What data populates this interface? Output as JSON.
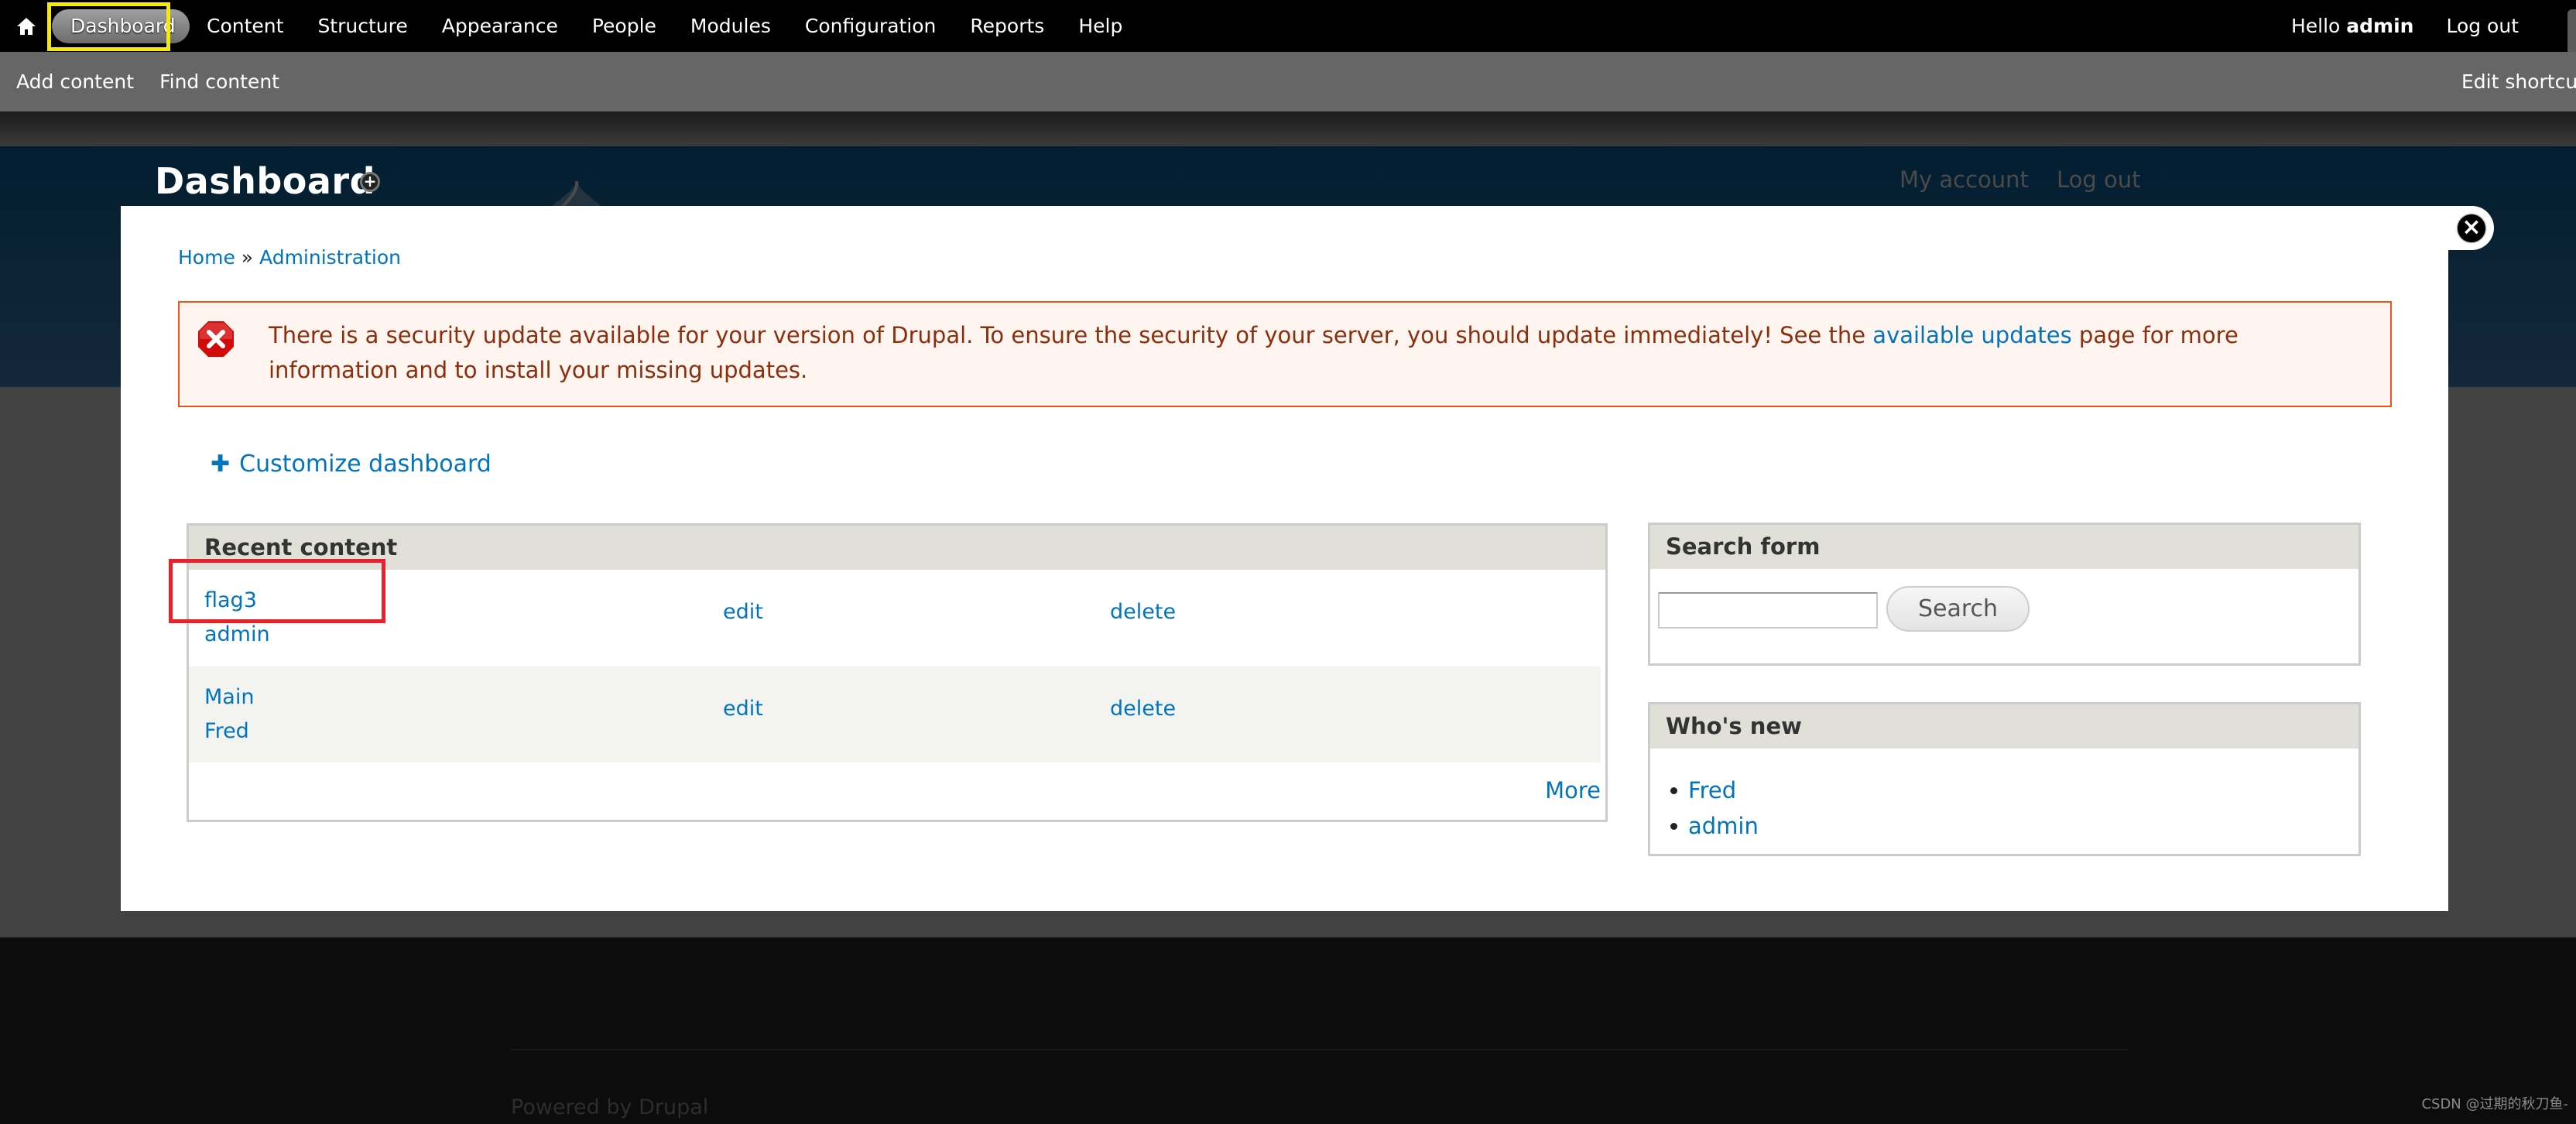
{
  "toolbar": {
    "home_icon": "home-icon",
    "menu": [
      {
        "label": "Dashboard",
        "active": true
      },
      {
        "label": "Content"
      },
      {
        "label": "Structure"
      },
      {
        "label": "Appearance"
      },
      {
        "label": "People"
      },
      {
        "label": "Modules"
      },
      {
        "label": "Configuration"
      },
      {
        "label": "Reports"
      },
      {
        "label": "Help"
      }
    ],
    "greeting_prefix": "Hello",
    "username": "admin",
    "logout": "Log out"
  },
  "shortcuts": {
    "items": [
      "Add content",
      "Find content"
    ],
    "edit_shortcuts": "Edit shortcuts"
  },
  "page_header": {
    "title": "Dashboard",
    "add_shortcut_icon": "plus-circle-icon",
    "secondary_menu": [
      "My account",
      "Log out"
    ]
  },
  "modal": {
    "close_icon": "close-icon",
    "breadcrumb": {
      "items": [
        "Home",
        "Administration"
      ],
      "separator": "»"
    },
    "message": {
      "type": "error",
      "icon": "error-icon",
      "text_before": "There is a security update available for your version of Drupal. To ensure the security of your server, you should update immediately! See the ",
      "link": "available updates",
      "text_after": " page for more information and to install your missing updates."
    },
    "customize": {
      "icon": "plus-icon",
      "label": "Customize dashboard"
    },
    "recent_content": {
      "title": "Recent content",
      "rows": [
        {
          "title": "flag3",
          "author": "admin",
          "edit": "edit",
          "delete": "delete"
        },
        {
          "title": "Main",
          "author": "Fred",
          "edit": "edit",
          "delete": "delete"
        }
      ],
      "more": "More"
    },
    "search_form": {
      "title": "Search form",
      "input_value": "",
      "button": "Search"
    },
    "whos_new": {
      "title": "Who's new",
      "users": [
        "Fred",
        "admin"
      ]
    }
  },
  "footer": {
    "powered_prefix": "Powered by",
    "powered_link": "Drupal"
  },
  "watermark": "CSDN @过期的秋刀鱼-",
  "colors": {
    "link": "#0074bd",
    "error_border": "#ed541d",
    "error_text": "#8c2e0b",
    "error_bg": "#fef5f1",
    "annotation_yellow": "#f5e90a",
    "annotation_red": "#e8212b"
  }
}
